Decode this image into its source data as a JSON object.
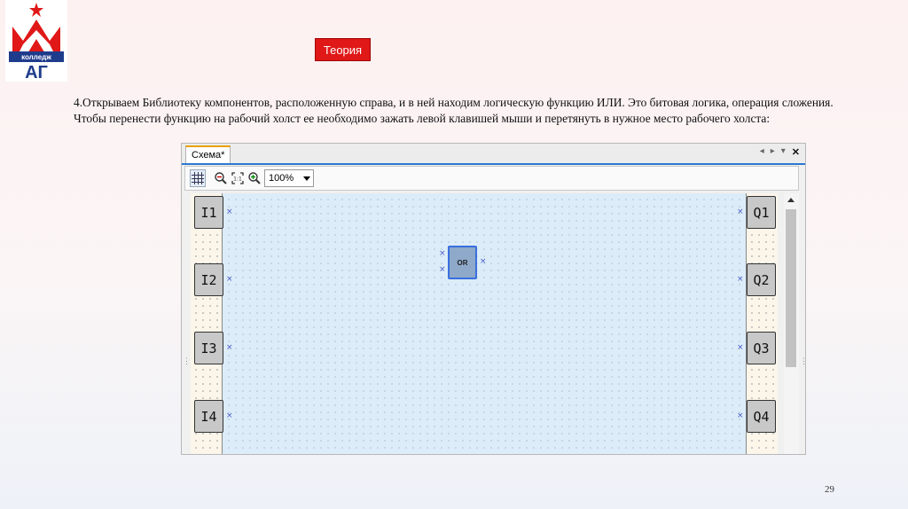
{
  "logo": {
    "text": "колледж",
    "letters": "АГ",
    "colors": {
      "red": "#e01818",
      "navy": "#1f3b8c"
    }
  },
  "header": {
    "theory_button": "Теория"
  },
  "body_text": "4.Открываем Библиотеку компонентов, расположенную справа, и в ней находим логическую функцию ИЛИ. Это битовая логика, операция сложения. Чтобы перенести функцию на рабочий холст ее необходимо зажать левой клавишей мыши и перетянуть в нужное место рабочего холста:",
  "window": {
    "tab_label": "Схема*",
    "tab_controls": [
      "◂",
      "▸",
      "▾",
      "✕"
    ],
    "toolbar": {
      "icons": [
        "grid-icon",
        "zoom-out-icon",
        "fit-icon",
        "zoom-in-icon"
      ],
      "zoom_value": "100%"
    },
    "inputs": [
      "I1",
      "I2",
      "I3",
      "I4"
    ],
    "outputs": [
      "Q1",
      "Q2",
      "Q3",
      "Q4"
    ],
    "block": {
      "label": "OR",
      "pin_glyph": "×"
    },
    "colors": {
      "canvas": "#dcecf8",
      "block_fill": "#8ea9c9",
      "block_border": "#3a6fe0",
      "tab_accent": "#2a78d0"
    }
  },
  "footer": {
    "page_number": "29"
  }
}
